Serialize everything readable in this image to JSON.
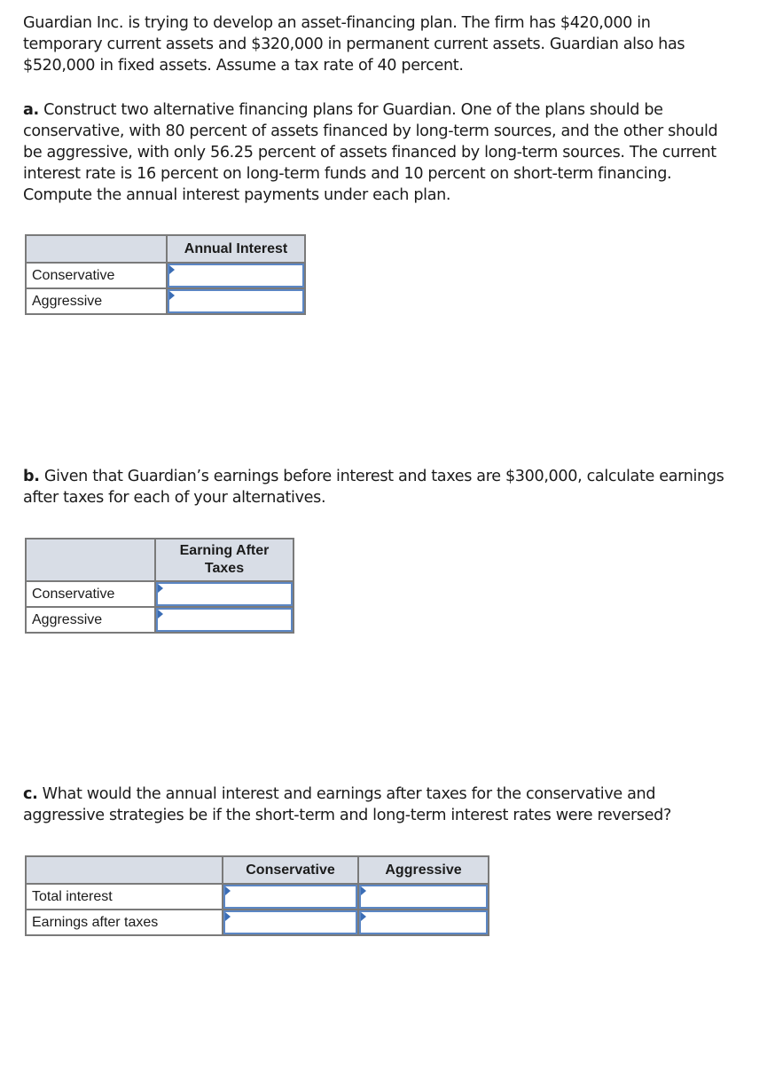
{
  "intro": "Guardian Inc. is trying to develop an asset-financing plan. The firm has $420,000 in temporary current assets and $320,000 in permanent current assets. Guardian also has $520,000 in fixed assets. Assume a tax rate of 40 percent.",
  "part_a": {
    "label": "a.",
    "text": " Construct two alternative financing plans for Guardian. One of the plans should be conservative, with 80 percent of assets financed by long-term sources, and the other should be aggressive, with only 56.25 percent of assets financed by long-term sources. The current interest rate is 16 percent on long-term funds and 10 percent on short-term financing. Compute the annual interest payments under each plan.",
    "table": {
      "header_blank": "",
      "column": "Annual Interest",
      "rows": [
        {
          "label": "Conservative",
          "value": ""
        },
        {
          "label": "Aggressive",
          "value": ""
        }
      ]
    }
  },
  "part_b": {
    "label": "b.",
    "text": " Given that Guardian’s earnings before interest and taxes are $300,000, calculate earnings after taxes for each of your alternatives.",
    "table": {
      "header_blank": "",
      "column": "Earning After Taxes",
      "rows": [
        {
          "label": "Conservative",
          "value": ""
        },
        {
          "label": "Aggressive",
          "value": ""
        }
      ]
    }
  },
  "part_c": {
    "label": "c.",
    "text": " What would the annual interest and earnings after taxes for the conservative and aggressive strategies be if the short-term and long-term interest rates were reversed?",
    "table": {
      "header_blank": "",
      "columns": [
        "Conservative",
        "Aggressive"
      ],
      "rows": [
        {
          "label": "Total interest",
          "values": [
            "",
            ""
          ]
        },
        {
          "label": "Earnings after taxes",
          "values": [
            "",
            ""
          ]
        }
      ]
    }
  },
  "colors": {
    "header_bg": "#d8dde6",
    "input_border": "#5b86c4",
    "flag": "#3b6db5",
    "table_border": "#7a7a7a"
  }
}
